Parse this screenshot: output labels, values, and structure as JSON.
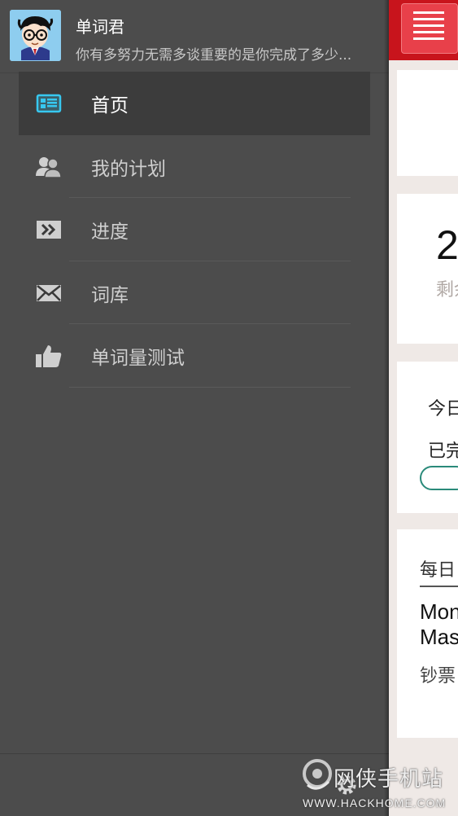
{
  "drawer": {
    "profile": {
      "name": "单词君",
      "tagline": "你有多努力无需多谈重要的是你完成了多少..."
    },
    "menu": [
      {
        "label": "首页",
        "icon": "home-list-icon",
        "active": true
      },
      {
        "label": "我的计划",
        "icon": "users-icon",
        "active": false
      },
      {
        "label": "进度",
        "icon": "forward-icon",
        "active": false
      },
      {
        "label": "词库",
        "icon": "envelope-icon",
        "active": false
      },
      {
        "label": "单词量测试",
        "icon": "thumbs-up-icon",
        "active": false
      }
    ]
  },
  "main": {
    "big_number": "2",
    "remaining_label": "剩余",
    "today_label": "今日",
    "completed_label": "已完",
    "daily_label": "每日",
    "english_line1": "Mon",
    "english_line2": "Mas",
    "chinese_line": "钞票"
  },
  "watermark": {
    "title": "网侠手机站",
    "url": "WWW.HACKHOME.COM"
  },
  "colors": {
    "drawer_bg": "#4c4c4c",
    "active_bg": "#3c3c3c",
    "accent_cyan": "#37c8f0",
    "topbar_red": "#c8141c"
  }
}
